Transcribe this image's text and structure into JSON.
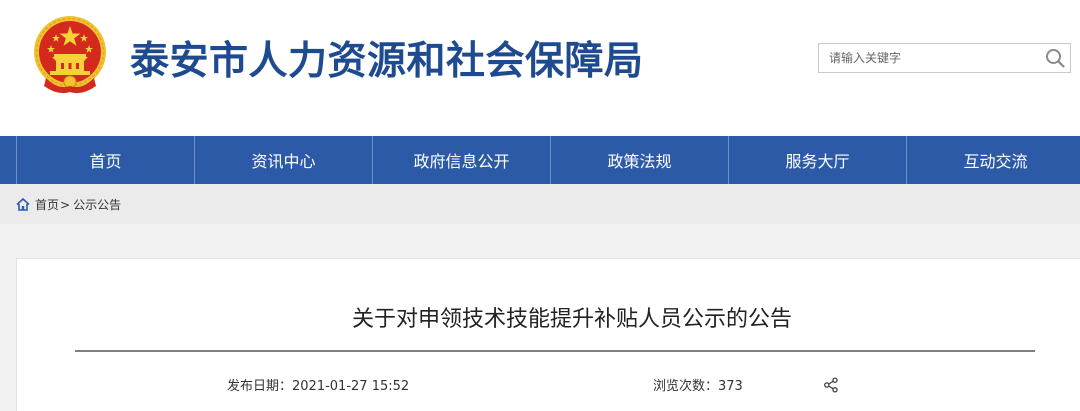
{
  "header": {
    "site_title": "泰安市人力资源和社会保障局",
    "emblem_icon": "national-emblem-icon"
  },
  "search": {
    "placeholder": "请输入关键字",
    "value": ""
  },
  "nav": {
    "items": [
      {
        "label": "首页"
      },
      {
        "label": "资讯中心"
      },
      {
        "label": "政府信息公开"
      },
      {
        "label": "政策法规"
      },
      {
        "label": "服务大厅"
      },
      {
        "label": "互动交流"
      }
    ]
  },
  "breadcrumb": {
    "home": "首页",
    "separator": ">",
    "current": "公示公告"
  },
  "article": {
    "title": "关于对申领技术技能提升补贴人员公示的公告",
    "publish_label": "发布日期：",
    "publish_date": "2021-01-27 15:52",
    "views_label": "浏览次数：",
    "views": "373"
  },
  "colors": {
    "brand_blue": "#1e4a8f",
    "nav_blue": "#2d5aa6",
    "emblem_red": "#d42a1e",
    "emblem_gold": "#f2c230"
  }
}
